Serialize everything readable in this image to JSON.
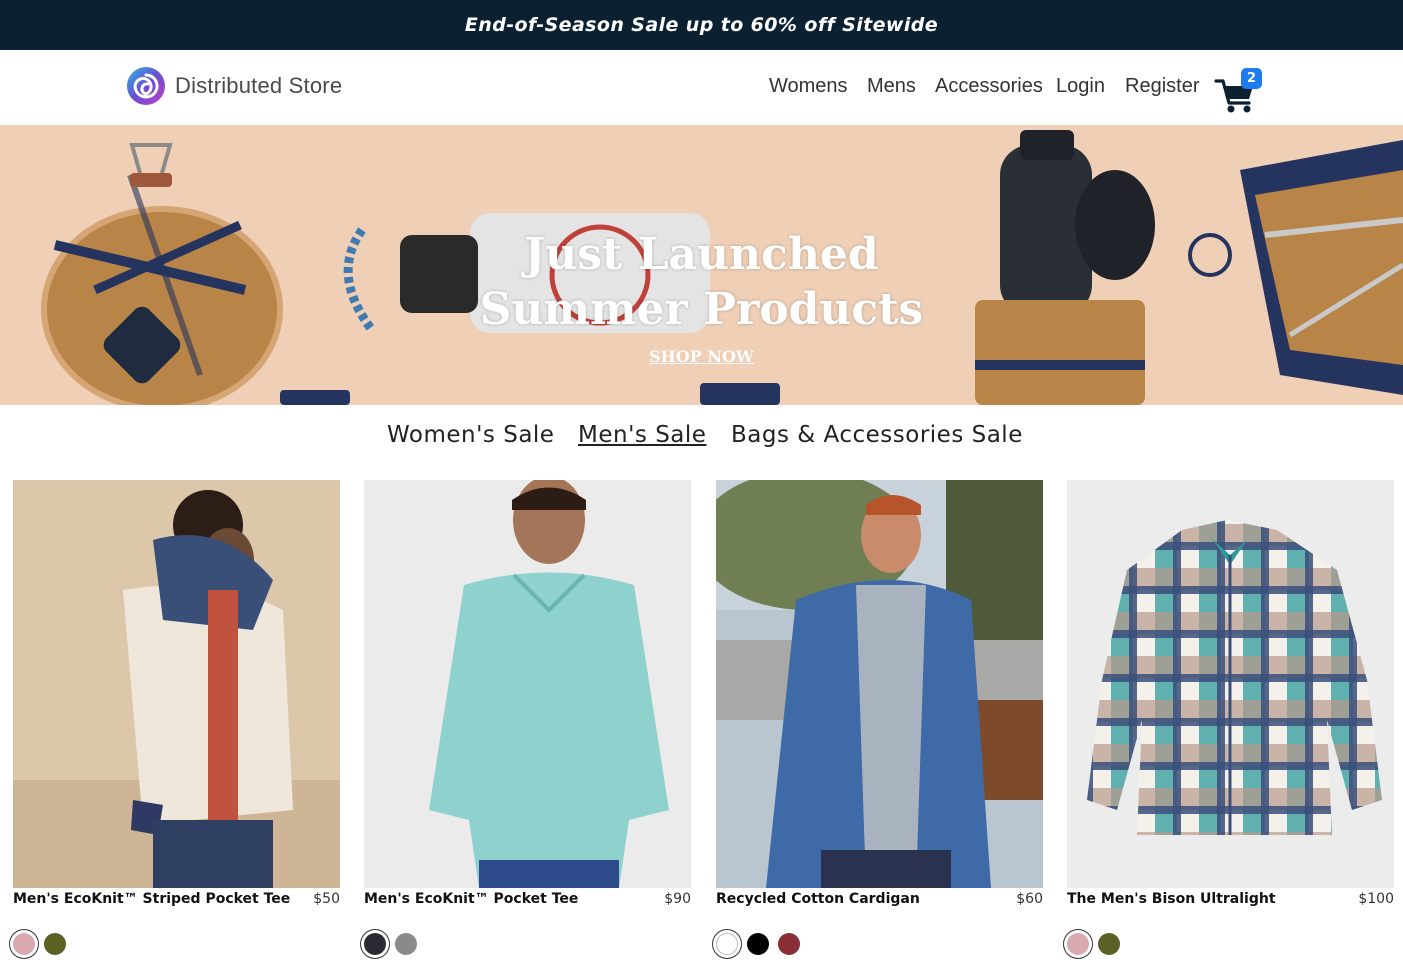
{
  "promo": {
    "text": "End-of-Season Sale up to 60% off Sitewide"
  },
  "header": {
    "logo_text": "Distributed Store",
    "nav": [
      "Womens",
      "Mens",
      "Accessories",
      "Login",
      "Register"
    ],
    "cart_count": "2"
  },
  "hero": {
    "title_line1": "Just Launched",
    "title_line2": "Summer Products",
    "cta": "SHOP NOW"
  },
  "categories": {
    "items": [
      "Women's Sale",
      "Men's Sale",
      "Bags & Accessories Sale"
    ],
    "active": "Men's Sale"
  },
  "products": [
    {
      "name": "Men's EcoKnit™ Striped Pocket Tee",
      "price": "$50",
      "swatches": [
        "#d9a9b2",
        "#5b6124"
      ]
    },
    {
      "name": "Men's EcoKnit™ Pocket Tee",
      "price": "$90",
      "swatches": [
        "#2a2a33",
        "#8a8a8a"
      ]
    },
    {
      "name": "Recycled Cotton Cardigan",
      "price": "$60",
      "swatches": [
        "#ffffff",
        "#000000",
        "#8a2e36"
      ]
    },
    {
      "name": "The Men's Bison Ultralight",
      "price": "$100",
      "swatches": [
        "#d9a9b2",
        "#5b6124"
      ]
    }
  ],
  "colors": {
    "promo_bg": "#0b2132",
    "badge": "#1e7cf0",
    "hero_bg": "#efcfb6"
  }
}
